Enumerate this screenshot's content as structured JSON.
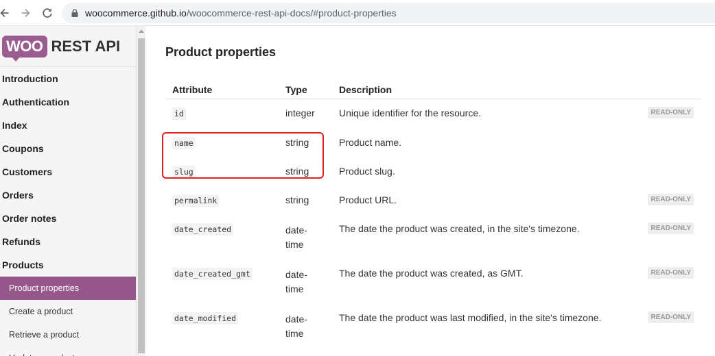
{
  "browser": {
    "url_host": "woocommerce.github.io",
    "url_path": "/woocommerce-rest-api-docs/#product-properties"
  },
  "sidebar": {
    "logo_badge": "WOO",
    "logo_text": "REST API",
    "items": [
      {
        "label": "Introduction"
      },
      {
        "label": "Authentication"
      },
      {
        "label": "Index"
      },
      {
        "label": "Coupons"
      },
      {
        "label": "Customers"
      },
      {
        "label": "Orders"
      },
      {
        "label": "Order notes"
      },
      {
        "label": "Refunds"
      },
      {
        "label": "Products"
      },
      {
        "label": "Product properties"
      },
      {
        "label": "Create a product"
      },
      {
        "label": "Retrieve a product"
      },
      {
        "label": "Update a product"
      }
    ]
  },
  "main": {
    "title": "Product properties",
    "headers": {
      "attribute": "Attribute",
      "type": "Type",
      "description": "Description"
    },
    "rows": [
      {
        "attribute": "id",
        "type": "integer",
        "description": "Unique identifier for the resource.",
        "badge": "READ-ONLY"
      },
      {
        "attribute": "name",
        "type": "string",
        "description": "Product name.",
        "badge": ""
      },
      {
        "attribute": "slug",
        "type": "string",
        "description": "Product slug.",
        "badge": ""
      },
      {
        "attribute": "permalink",
        "type": "string",
        "description": "Product URL.",
        "badge": "READ-ONLY"
      },
      {
        "attribute": "date_created",
        "type": "date-time",
        "description": "The date the product was created, in the site's timezone.",
        "badge": "READ-ONLY"
      },
      {
        "attribute": "date_created_gmt",
        "type": "date-time",
        "description": "The date the product was created, as GMT.",
        "badge": "READ-ONLY"
      },
      {
        "attribute": "date_modified",
        "type": "date-time",
        "description": "The date the product was last modified, in the site's timezone.",
        "badge": "READ-ONLY"
      }
    ]
  },
  "colors": {
    "accent": "#96588a",
    "highlight": "#e02020"
  }
}
